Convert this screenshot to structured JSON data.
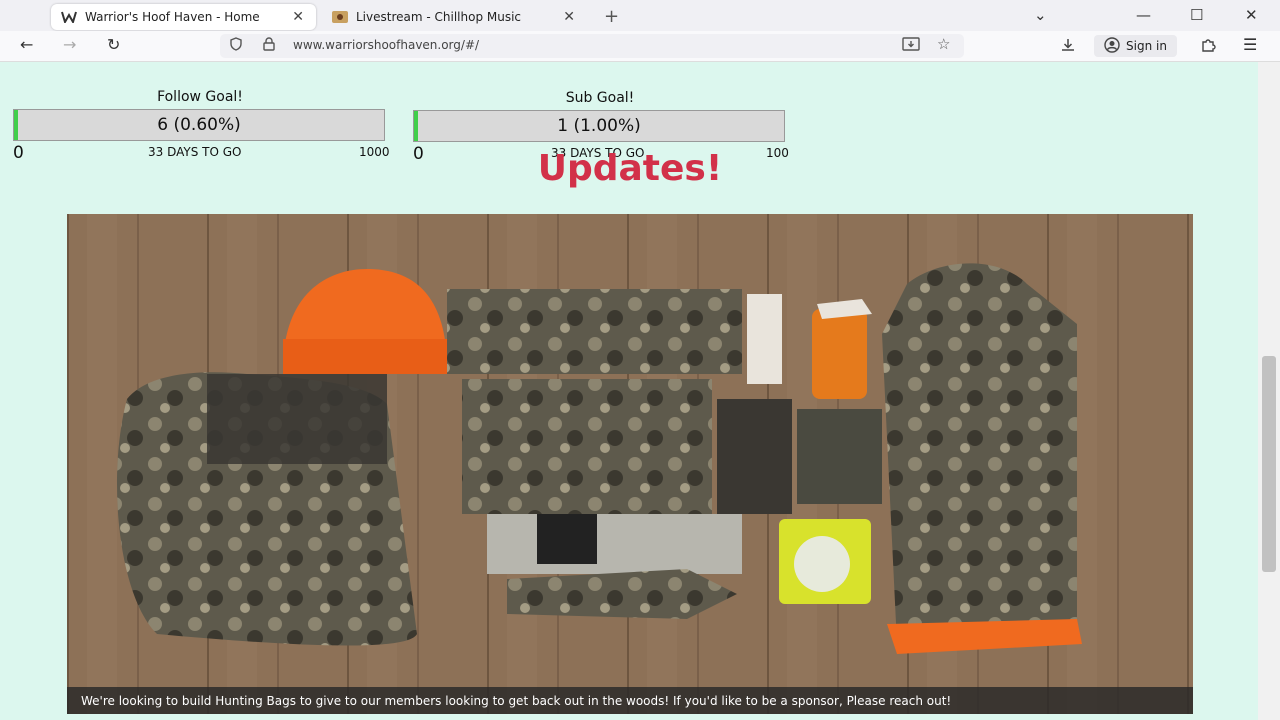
{
  "browser": {
    "tabs": [
      {
        "title": "Warrior's Hoof Haven - Home",
        "icon": "w-logo-icon"
      },
      {
        "title": "Livestream - Chillhop Music",
        "icon": "chillhop-icon"
      }
    ],
    "new_tab_label": "+",
    "url": "www.warriorshoofhaven.org/#/",
    "sign_in": "Sign in"
  },
  "goals": [
    {
      "title": "Follow Goal!",
      "display": "6 (0.60%)",
      "current": 6,
      "min_label": "0",
      "max_label": "1000",
      "remaining": "33 DAYS TO GO",
      "progress": 0.006
    },
    {
      "title": "Sub Goal!",
      "display": "1 (1.00%)",
      "current": 1,
      "min_label": "0",
      "max_label": "100",
      "remaining": "33 DAYS TO GO",
      "progress": 0.01
    }
  ],
  "updates": {
    "heading": "Updates!",
    "caption": "We're looking to build Hunting Bags to give to our members looking to get back out in the woods! If you'd like to be a sponsor, Please reach out!"
  },
  "colors": {
    "accent": "#d23149",
    "progress": "#3fcf4a",
    "background": "#dcf7ee"
  }
}
